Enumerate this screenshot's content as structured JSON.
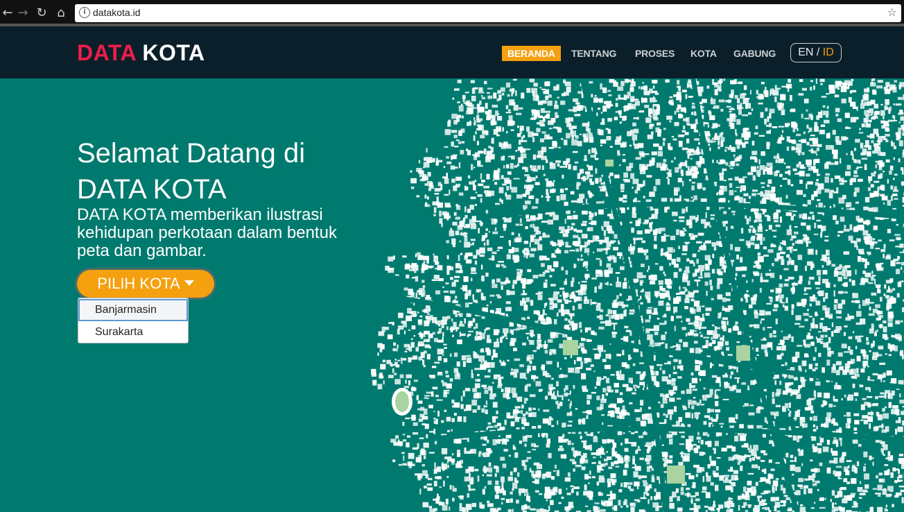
{
  "browser": {
    "url": "datakota.id",
    "back_icon": "back-arrow-icon",
    "forward_icon": "forward-arrow-icon",
    "reload_icon": "reload-icon",
    "home_icon": "home-icon",
    "info_icon": "info-icon",
    "star_icon": "bookmark-star-icon"
  },
  "navbar": {
    "brand_part1": "DATA",
    "brand_part2": "KOTA",
    "items": [
      {
        "label": "BERANDA",
        "active": true
      },
      {
        "label": "TENTANG",
        "active": false
      },
      {
        "label": "PROSES",
        "active": false
      },
      {
        "label": "KOTA",
        "active": false
      },
      {
        "label": "GABUNG",
        "active": false
      }
    ],
    "lang": {
      "en": "EN",
      "separator": "/",
      "id": "ID",
      "active": "ID"
    }
  },
  "hero": {
    "title_line1": "Selamat Datang di",
    "title_line2": "DATA KOTA",
    "subtitle": "DATA KOTA memberikan ilustrasi kehidupan perkotaan dalam bentuk peta dan gambar.",
    "button_label": "PILIH KOTA",
    "dropdown_options": [
      "Banjarmasin",
      "Surakarta"
    ]
  },
  "colors": {
    "background": "#007a6e",
    "navbar": "#0b1f2a",
    "accent_orange": "#f5a00f",
    "brand_red": "#ee1c4a"
  }
}
